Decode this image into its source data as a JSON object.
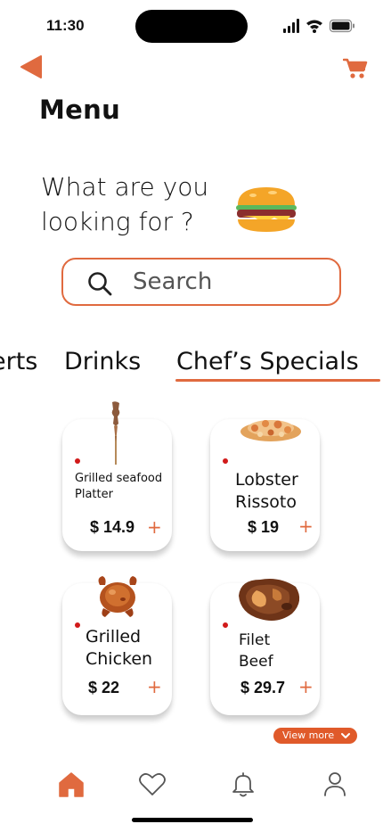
{
  "status_bar": {
    "time": "11:30",
    "icons": [
      "signal-icon",
      "wifi-icon",
      "battery-icon"
    ]
  },
  "header": {
    "back_icon": "back-arrow-icon",
    "cart_icon": "cart-icon",
    "title": "Menu"
  },
  "hero": {
    "question_line1": "What are you",
    "question_line2": "looking for ?",
    "illustration": "burger-icon"
  },
  "search": {
    "placeholder": "Search",
    "value": ""
  },
  "categories": {
    "items": [
      {
        "label": "Desserts",
        "visible_text": "erts",
        "selected": false
      },
      {
        "label": "Drinks",
        "visible_text": "Drinks",
        "selected": false
      },
      {
        "label": "Chef’s Specials",
        "visible_text": "Chef’s Specials",
        "selected": true
      }
    ]
  },
  "menu_items": [
    {
      "name_line1": "Grilled seafood",
      "name_line2": "Platter",
      "price": "$ 14.9",
      "add": "+",
      "image": "seafood-skewer-image"
    },
    {
      "name_line1": "Lobster",
      "name_line2": "Rissoto",
      "price": "$ 19",
      "add": "+",
      "image": "lobster-risotto-image"
    },
    {
      "name_line1": "Grilled",
      "name_line2": "Chicken",
      "price": "$ 22",
      "add": "+",
      "image": "grilled-chicken-image"
    },
    {
      "name_line1": "Filet",
      "name_line2": "Beef",
      "price": "$ 29.7",
      "add": "+",
      "image": "filet-beef-image"
    }
  ],
  "view_more": {
    "label": "View more"
  },
  "bottom_nav": {
    "items": [
      {
        "icon": "home-icon",
        "active": true
      },
      {
        "icon": "heart-icon",
        "active": false
      },
      {
        "icon": "bell-icon",
        "active": false
      },
      {
        "icon": "user-icon",
        "active": false
      }
    ]
  },
  "colors": {
    "accent": "#E06A3F",
    "view_more_bg": "#E05A2A",
    "dot": "#D11A1A",
    "text": "#111111"
  }
}
